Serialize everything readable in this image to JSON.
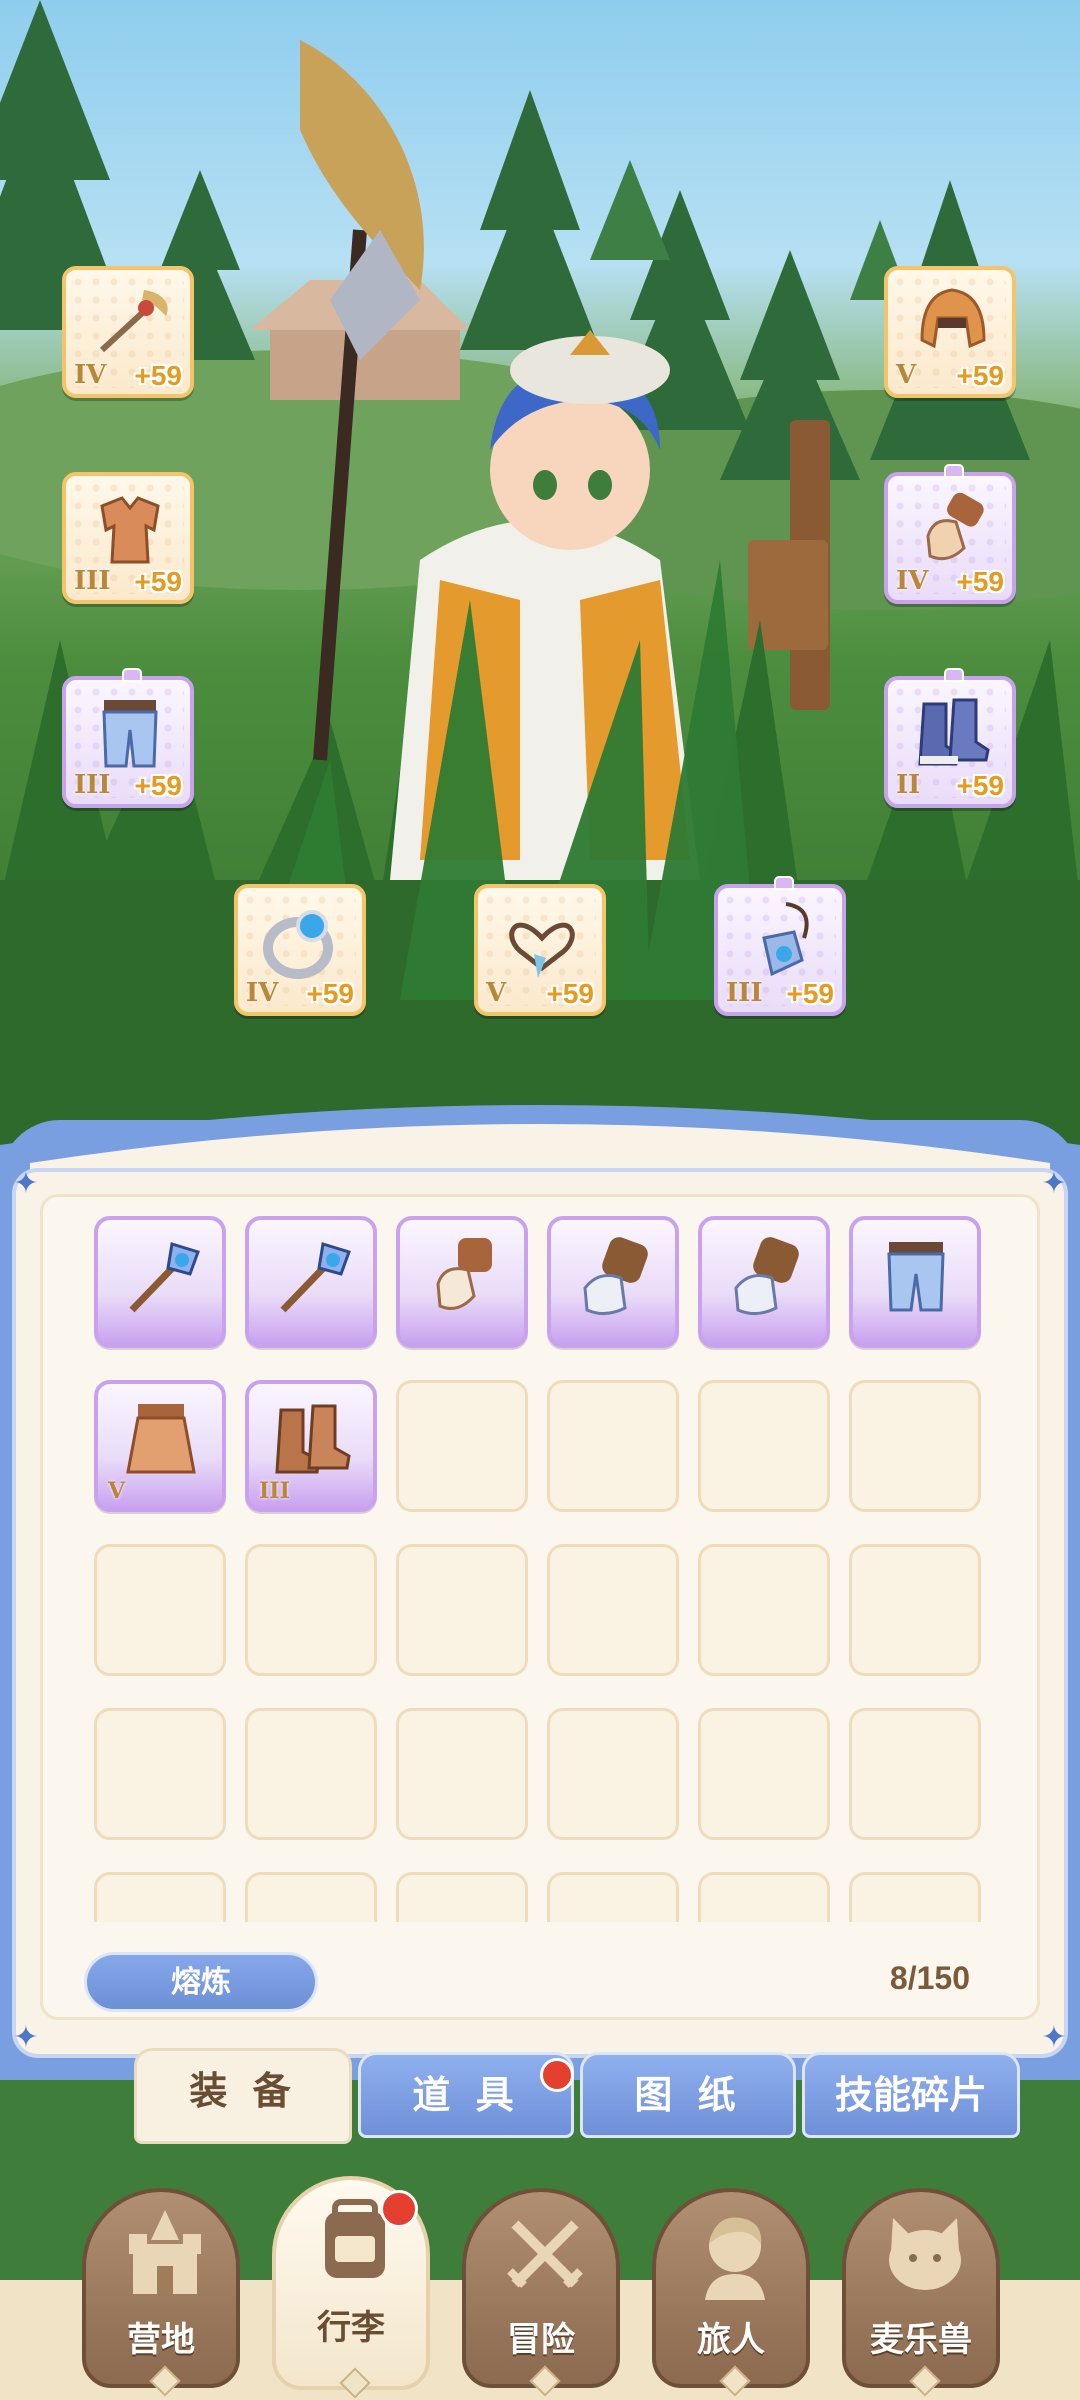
{
  "equipped": [
    {
      "slot": "weapon",
      "tier": "IV",
      "level": "+59",
      "rarity": "gold",
      "icon": "staff-icon"
    },
    {
      "slot": "helmet",
      "tier": "V",
      "level": "+59",
      "rarity": "gold",
      "icon": "helmet-icon"
    },
    {
      "slot": "armor",
      "tier": "III",
      "level": "+59",
      "rarity": "gold",
      "icon": "armor-icon"
    },
    {
      "slot": "gloves",
      "tier": "IV",
      "level": "+59",
      "rarity": "purple",
      "icon": "glove-icon"
    },
    {
      "slot": "pants",
      "tier": "III",
      "level": "+59",
      "rarity": "purple",
      "icon": "pants-icon"
    },
    {
      "slot": "boots",
      "tier": "II",
      "level": "+59",
      "rarity": "purple",
      "icon": "boots-icon"
    },
    {
      "slot": "ring",
      "tier": "IV",
      "level": "+59",
      "rarity": "gold",
      "icon": "ring-icon"
    },
    {
      "slot": "necklace",
      "tier": "V",
      "level": "+59",
      "rarity": "gold",
      "icon": "necklace-icon"
    },
    {
      "slot": "amulet",
      "tier": "III",
      "level": "+59",
      "rarity": "purple",
      "icon": "amulet-icon"
    }
  ],
  "inventory": {
    "items": [
      {
        "icon": "staff-icon",
        "tier": ""
      },
      {
        "icon": "staff-icon",
        "tier": ""
      },
      {
        "icon": "glove-icon",
        "tier": ""
      },
      {
        "icon": "gauntlet-icon",
        "tier": ""
      },
      {
        "icon": "gauntlet-icon",
        "tier": ""
      },
      {
        "icon": "pants-icon",
        "tier": ""
      },
      {
        "icon": "skirt-icon",
        "tier": "V"
      },
      {
        "icon": "boots-icon",
        "tier": "III"
      }
    ],
    "smelt_label": "熔炼",
    "capacity": "8/150"
  },
  "tabs": [
    {
      "label": "装 备",
      "active": true,
      "badge": false
    },
    {
      "label": "道 具",
      "active": false,
      "badge": true
    },
    {
      "label": "图 纸",
      "active": false,
      "badge": false
    },
    {
      "label": "技能碎片",
      "active": false,
      "badge": false
    }
  ],
  "nav": [
    {
      "label": "营地",
      "icon": "castle-icon",
      "active": false,
      "badge": false
    },
    {
      "label": "行李",
      "icon": "backpack-icon",
      "active": true,
      "badge": true
    },
    {
      "label": "冒险",
      "icon": "crossed-swords-icon",
      "active": false,
      "badge": false
    },
    {
      "label": "旅人",
      "icon": "traveler-icon",
      "active": false,
      "badge": false
    },
    {
      "label": "麦乐兽",
      "icon": "cat-icon",
      "active": false,
      "badge": false
    }
  ],
  "colors": {
    "gold_border": "#f3c46a",
    "purple_border": "#c9a2ee",
    "tab_blue": "#7a9fe0",
    "badge_red": "#e5402f"
  }
}
